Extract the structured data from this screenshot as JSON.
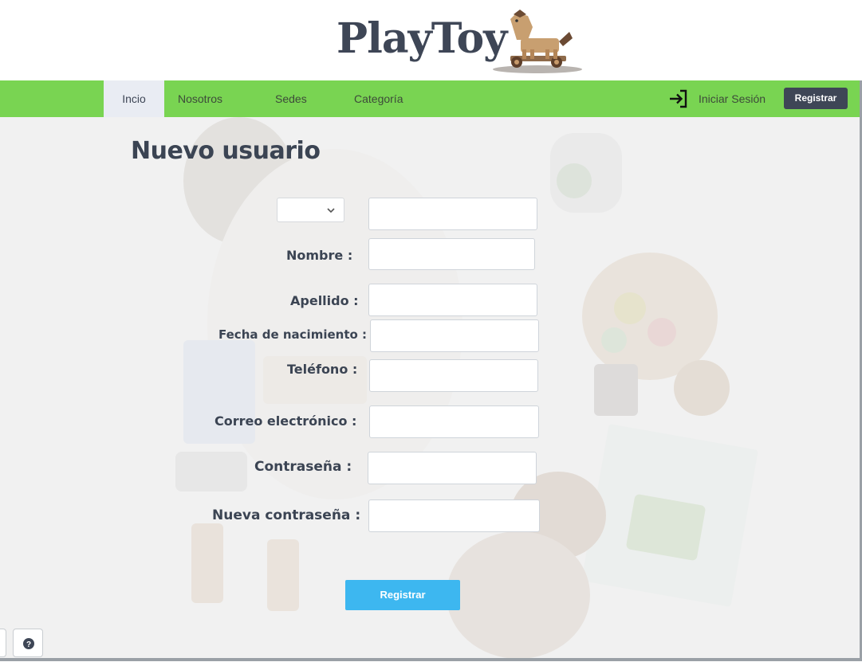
{
  "brand": {
    "name": "PlayToy",
    "logo_icon": "wooden-horse-icon"
  },
  "nav": {
    "items": [
      {
        "label": "Incio",
        "active": true
      },
      {
        "label": "Nosotros",
        "active": false
      },
      {
        "label": "Sedes",
        "active": false
      },
      {
        "label": "Categoría",
        "active": false
      }
    ],
    "login_label": "Iniciar Sesión",
    "login_icon": "sign-in-icon",
    "register_label": "Registrar"
  },
  "form": {
    "title": "Nuevo usuario",
    "document_type": {
      "value": "",
      "icon": "chevron-down-icon"
    },
    "document_number": {
      "value": ""
    },
    "fields": [
      {
        "label": "Nombre :",
        "value": ""
      },
      {
        "label": "Apellido :",
        "value": ""
      },
      {
        "label": "Fecha de nacimiento :",
        "value": ""
      },
      {
        "label": "Teléfono :",
        "value": ""
      },
      {
        "label": "Correo electrónico :",
        "value": ""
      },
      {
        "label": "Contraseña :",
        "value": ""
      },
      {
        "label": "Nueva contraseña :",
        "value": ""
      }
    ],
    "submit_label": "Registrar"
  },
  "help": {
    "icon": "question-circle-icon"
  },
  "colors": {
    "nav_green": "#79d452",
    "dark": "#3e4656",
    "submit_blue": "#3db7f0",
    "active_tab": "#e9ecf3"
  }
}
